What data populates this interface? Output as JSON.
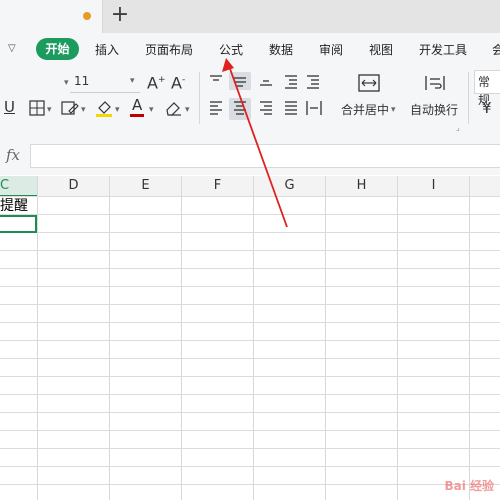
{
  "titlebar": {
    "new_tab_symbol": "+",
    "unsaved_dot_color": "#e99a23"
  },
  "ribbon": {
    "menu": {
      "active": "开始",
      "items": [
        "插入",
        "页面布局",
        "公式",
        "数据",
        "审阅",
        "视图",
        "开发工具",
        "会"
      ]
    },
    "accent_color": "#1c9b5f"
  },
  "toolbar": {
    "font_size": "11",
    "merge_center": "合并居中",
    "wrap_text": "自动换行",
    "number_format": "常规",
    "currency_symbol": "¥",
    "font_color": "#c00000",
    "fill_color": "#f5d800"
  },
  "formula_bar": {
    "fx": "fx",
    "value": ""
  },
  "grid": {
    "columns": [
      "C",
      "D",
      "E",
      "F",
      "G",
      "H",
      "I"
    ],
    "selected_column": "C",
    "cells": {
      "C1": "提醒"
    }
  },
  "annotation": {
    "arrow_color": "#e02020"
  },
  "watermark": "Bai 经验"
}
